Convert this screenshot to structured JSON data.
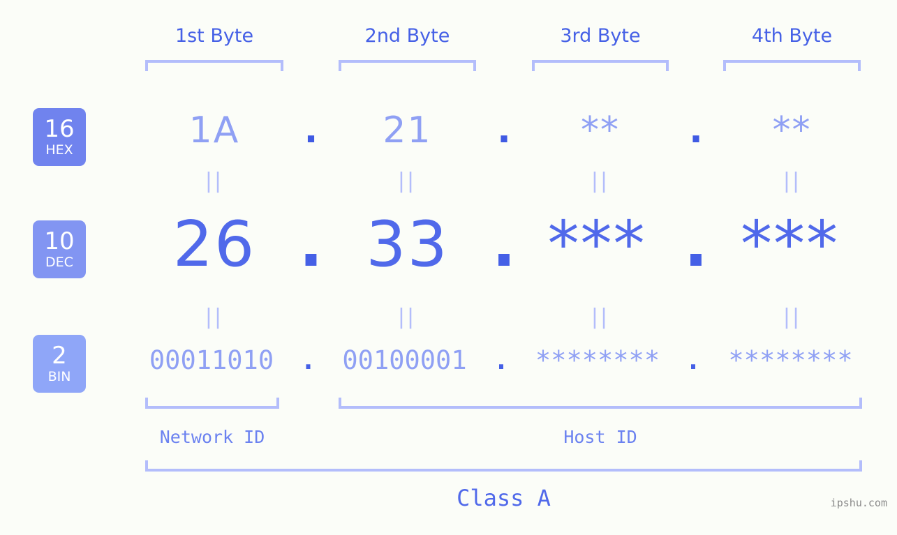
{
  "meta": {
    "background_color": "#fbfdf8",
    "accent_color": "#4560e6",
    "light_accent_color": "#8fa0f4",
    "bracket_color": "#b3bdfb",
    "watermark": "ipshu.com"
  },
  "byte_headers": [
    {
      "label": "1st Byte"
    },
    {
      "label": "2nd Byte"
    },
    {
      "label": "3rd Byte"
    },
    {
      "label": "4th Byte"
    }
  ],
  "rows": [
    {
      "id": "hex",
      "badge_number": "16",
      "badge_name": "HEX",
      "badge_color": "#7083ee",
      "values": [
        "1A",
        "21",
        "**",
        "**"
      ],
      "separator": "."
    },
    {
      "id": "dec",
      "badge_number": "10",
      "badge_name": "DEC",
      "badge_color": "#8295f2",
      "values": [
        "26",
        "33",
        "***",
        "***"
      ],
      "separator": "."
    },
    {
      "id": "bin",
      "badge_number": "2",
      "badge_name": "BIN",
      "badge_color": "#8fa6f8",
      "values": [
        "00011010",
        "00100001",
        "********",
        "********"
      ],
      "separator": "."
    }
  ],
  "equivalence_marks": [
    {
      "label": "||"
    },
    {
      "label": "||"
    },
    {
      "label": "||"
    },
    {
      "label": "||"
    },
    {
      "label": "||"
    },
    {
      "label": "||"
    },
    {
      "label": "||"
    },
    {
      "label": "||"
    }
  ],
  "id_sections": [
    {
      "label": "Network ID"
    },
    {
      "label": "Host ID"
    }
  ],
  "class_section": {
    "label": "Class A"
  }
}
